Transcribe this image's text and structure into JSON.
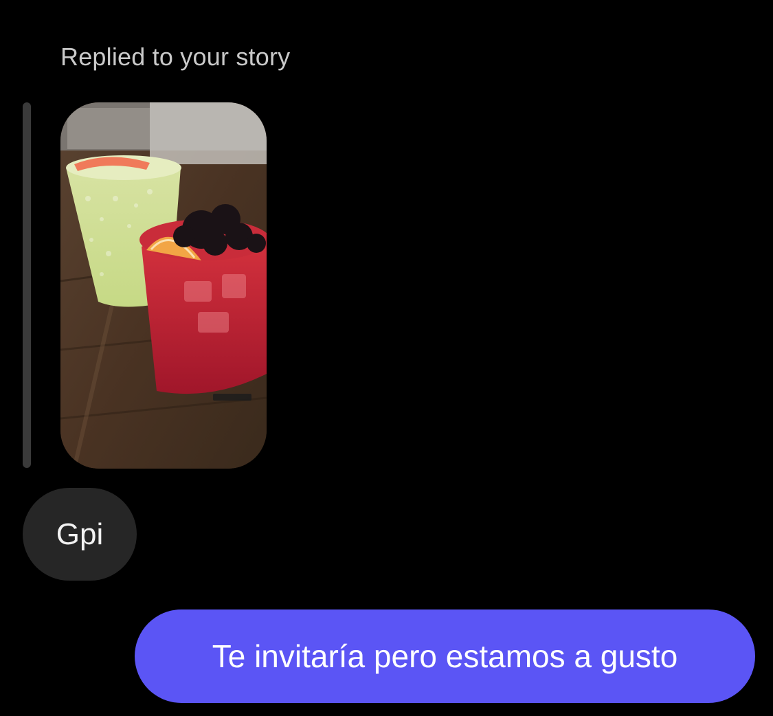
{
  "thread": {
    "reply_caption": "Replied to your story",
    "story": {
      "image_alt": "Story photo of two cocktails on a wooden bar"
    },
    "messages": [
      {
        "sender": "them",
        "text": "Gpi"
      },
      {
        "sender": "me",
        "text": "Te invitaría pero estamos a gusto"
      }
    ]
  },
  "colors": {
    "background": "#000000",
    "incoming_bubble": "#262626",
    "outgoing_bubble": "#5b55f5",
    "caption_text": "#c9c9c9",
    "reply_bar": "#3a3a3a"
  }
}
